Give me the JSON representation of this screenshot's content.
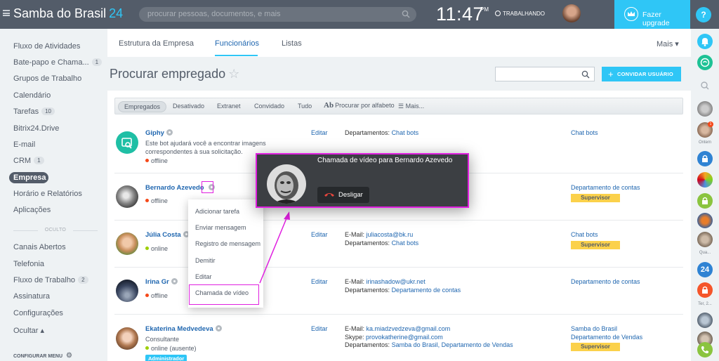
{
  "header": {
    "logo_main": "Samba do Brasil",
    "logo_num": "24",
    "search_placeholder": "procurar pessoas, documentos, e mais",
    "clock": "11:47",
    "clock_suffix": "PM",
    "work_status": "TRABALHANDO",
    "upgrade_label": "Fazer upgrade",
    "help_label": "?"
  },
  "left_menu": {
    "items": [
      {
        "label": "Fluxo de Atividades"
      },
      {
        "label": "Bate-papo e Chama...",
        "count": "1"
      },
      {
        "label": "Grupos de Trabalho"
      },
      {
        "label": "Calendário"
      },
      {
        "label": "Tarefas",
        "count": "10"
      },
      {
        "label": "Bitrix24.Drive"
      },
      {
        "label": "E-mail"
      },
      {
        "label": "CRM",
        "count": "1"
      },
      {
        "label": "Empresa"
      },
      {
        "label": "Horário e Relatórios"
      },
      {
        "label": "Aplicações"
      }
    ],
    "hidden_label": "OCULTO",
    "hidden_items": [
      {
        "label": "Canais Abertos"
      },
      {
        "label": "Telefonia"
      },
      {
        "label": "Fluxo de Trabalho",
        "count": "2"
      },
      {
        "label": "Assinatura"
      },
      {
        "label": "Configurações"
      },
      {
        "label": "Ocultar ▴"
      }
    ],
    "config_label": "CONFIGURAR MENU"
  },
  "tabs": {
    "items": [
      "Estrutura da Empresa",
      "Funcionários",
      "Listas"
    ],
    "active": "Funcionários",
    "more_label": "Mais ▾"
  },
  "page": {
    "title": "Procurar empregado",
    "star": "☆",
    "invite_label": "CONVIDAR USUÁRIO"
  },
  "filters": {
    "items": [
      "Empregados",
      "Desativado",
      "Extranet",
      "Convidado",
      "Tudo"
    ],
    "alpha_icon": "Ab",
    "alpha_label": "Procurar por alfabeto",
    "more_label": "Mais..."
  },
  "employees": [
    {
      "name": "Giphy",
      "description": "Este bot ajudará você a encontrar imagens correspondentes à sua solicitação.",
      "status": "offline",
      "edit": "Editar",
      "dept_label": "Departamentos:",
      "dept_value": "Chat bots",
      "right_dept": "Chat bots"
    },
    {
      "name": "Bernardo Azevedo",
      "status": "offline",
      "right_dept": "Departamento de contas",
      "badge": "Supervisor"
    },
    {
      "name": "Júlia Costa",
      "status": "online",
      "edit": "Editar",
      "email_label": "E-Mail:",
      "email": "juliacosta@bk.ru",
      "dept_label": "Departamentos:",
      "dept_value": "Chat bots",
      "right_dept": "Chat bots",
      "badge": "Supervisor"
    },
    {
      "name": "Irina Gr",
      "status": "offline",
      "edit": "Editar",
      "email_label": "E-Mail:",
      "email": "irinashadow@ukr.net",
      "dept_label": "Departamentos:",
      "dept_value": "Departamento de contas",
      "right_dept": "Departamento de contas"
    },
    {
      "name": "Ekaterina Medvedeva",
      "position": "Consultante",
      "status": "online (ausente)",
      "edit": "Editar",
      "email_label": "E-Mail:",
      "email": "ka.miadzvedzeva@gmail.com",
      "skype_label": "Skype:",
      "skype": "provokatherine@gmail.com",
      "dept_label": "Departamentos:",
      "dept_value": "Samba do Brasil, Departamento de Vendas",
      "right_dept": "Samba do Brasil",
      "right_dept2": "Departamento de Vendas",
      "badge": "Supervisor",
      "role_badge": "Administrador"
    }
  ],
  "context_menu": {
    "items": [
      "Adicionar tarefa",
      "Enviar mensagem",
      "Registro de mensagem",
      "Demitir",
      "Editar",
      "Chamada de vídeo"
    ]
  },
  "video_call": {
    "title": "Chamada de vídeo para Bernardo Azevedo",
    "hangup_label": "Desligar"
  },
  "right_bar": {
    "label_ontem": "Ontem",
    "label_qua": "Qua...",
    "label_ter": "Ter, 2...",
    "badge_count": "1",
    "app_num": "24"
  },
  "colors": {
    "accent": "#2fc6f6",
    "topbar": "#535c69",
    "link": "#2067b0",
    "supervisor": "#fbd14b",
    "highlight": "#e020e0",
    "offline": "#f54819",
    "online": "#9dcf00"
  }
}
